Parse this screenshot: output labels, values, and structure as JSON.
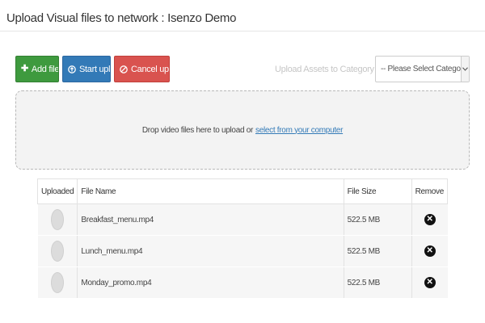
{
  "page": {
    "title": "Upload Visual files to network : Isenzo Demo"
  },
  "toolbar": {
    "add_label": "Add files...",
    "start_label": "Start upload",
    "cancel_label": "Cancel upload",
    "category_label": "Upload Assets to Category >>",
    "category_selected": "-- Please Select Category --"
  },
  "dropzone": {
    "text": "Drop video files here to upload or",
    "link_text": "select from your computer"
  },
  "table": {
    "headers": {
      "uploaded": "Uploaded",
      "file_name": "File Name",
      "file_size": "File Size",
      "remove": "Remove"
    },
    "rows": [
      {
        "file_name": "Breakfast_menu.mp4",
        "file_size": "522.5 MB"
      },
      {
        "file_name": "Lunch_menu.mp4",
        "file_size": "522.5 MB"
      },
      {
        "file_name": "Monday_promo.mp4",
        "file_size": "522.5 MB"
      }
    ]
  },
  "icons": {
    "add": "plus-icon",
    "start": "upload-icon",
    "cancel": "ban-icon",
    "select": "chevron-down-icon",
    "remove": "close-circle-icon"
  },
  "colors": {
    "add_button": "#3e9a3e",
    "start_button": "#337ab7",
    "cancel_button": "#d9534f",
    "link": "#337ab7"
  }
}
